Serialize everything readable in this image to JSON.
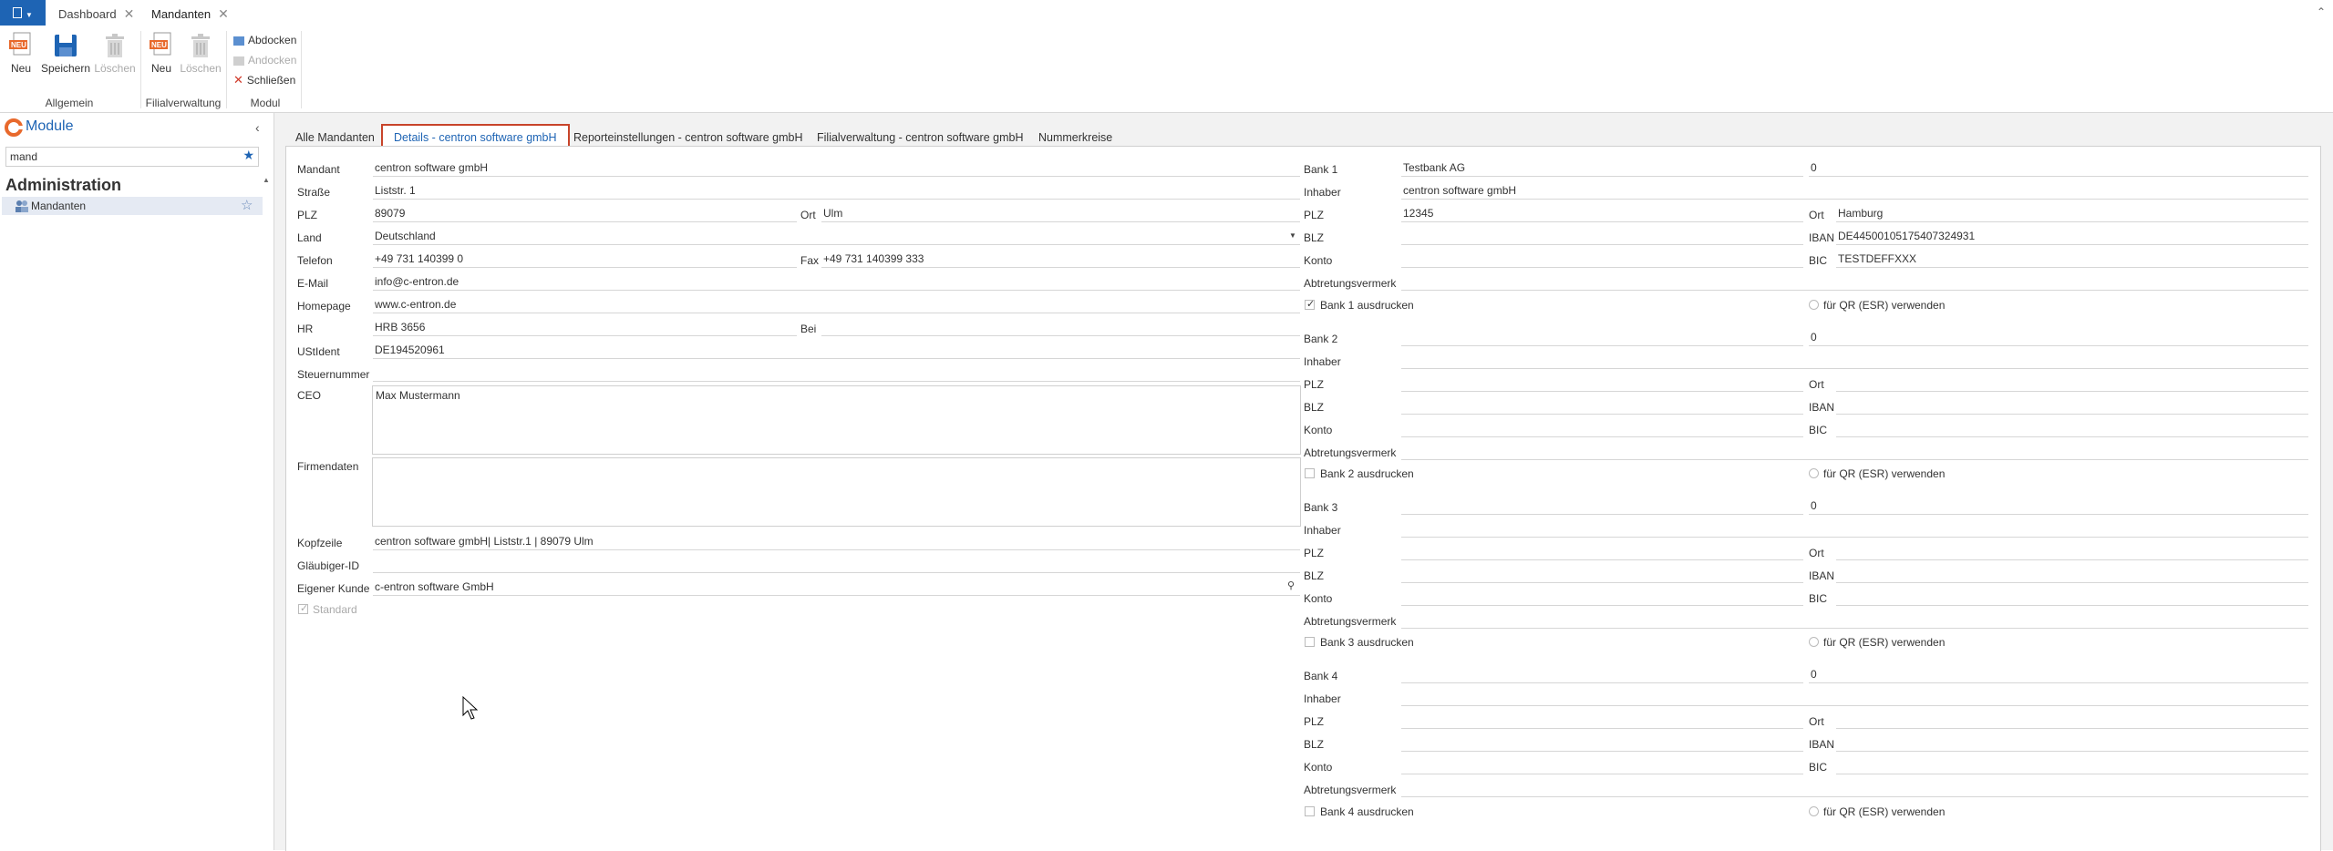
{
  "tabs": {
    "dashboard": "Dashboard",
    "mandanten": "Mandanten"
  },
  "ribbon": {
    "allgemein": {
      "neu": "Neu",
      "speichern": "Speichern",
      "loeschen": "Löschen",
      "label": "Allgemein"
    },
    "filialverwaltung": {
      "neu": "Neu",
      "loeschen": "Löschen",
      "label": "Filialverwaltung"
    },
    "modul": {
      "abdocken": "Abdocken",
      "andocken": "Andocken",
      "schliessen": "Schließen",
      "label": "Modul"
    }
  },
  "sidebar": {
    "title": "Module",
    "search_value": "mand",
    "section": "Administration",
    "item": "Mandanten"
  },
  "subtabs": [
    "Alle Mandanten",
    "Details - centron software gmbH",
    "Reporteinstellungen - centron software gmbH",
    "Filialverwaltung - centron software gmbH",
    "Nummerkreise"
  ],
  "form": {
    "mandant_label": "Mandant",
    "mandant": "centron software gmbH",
    "strasse_label": "Straße",
    "strasse": "Liststr. 1",
    "plz_label": "PLZ",
    "plz": "89079",
    "ort_label": "Ort",
    "ort": "Ulm",
    "land_label": "Land",
    "land": "Deutschland",
    "telefon_label": "Telefon",
    "telefon": "+49 731 140399 0",
    "fax_label": "Fax",
    "fax": "+49 731 140399 333",
    "email_label": "E-Mail",
    "email": "info@c-entron.de",
    "homepage_label": "Homepage",
    "homepage": "www.c-entron.de",
    "hr_label": "HR",
    "hr": "HRB 3656",
    "bei_label": "Bei",
    "bei": "",
    "ustident_label": "UStIdent",
    "ustident": "DE194520961",
    "steuernummer_label": "Steuernummer",
    "steuernummer": "",
    "ceo_label": "CEO",
    "ceo": "Max Mustermann",
    "firmendaten_label": "Firmendaten",
    "firmendaten": "",
    "kopfzeile_label": "Kopfzeile",
    "kopfzeile": "centron software gmbH| Liststr.1 | 89079  Ulm",
    "glaeubiger_label": "Gläubiger-ID",
    "glaeubiger": "",
    "eigener_kunde_label": "Eigener Kunde",
    "eigener_kunde": "c-entron software GmbH",
    "standard_label": "Standard"
  },
  "banks": [
    {
      "label": "Bank 1",
      "name": "Testbank AG",
      "number": "0",
      "inhaber_label": "Inhaber",
      "inhaber": "centron software gmbH",
      "plz_label": "PLZ",
      "plz": "12345",
      "ort_label": "Ort",
      "ort": "Hamburg",
      "blz_label": "BLZ",
      "blz": "",
      "iban_label": "IBAN",
      "iban": "DE44500105175407324931",
      "konto_label": "Konto",
      "konto": "",
      "bic_label": "BIC",
      "bic": "TESTDEFFXXX",
      "abtretung_label": "Abtretungsvermerk",
      "print_label": "Bank 1 ausdrucken",
      "qr_label": "für QR (ESR) verwenden"
    },
    {
      "label": "Bank 2",
      "name": "",
      "number": "0",
      "inhaber_label": "Inhaber",
      "inhaber": "",
      "plz_label": "PLZ",
      "plz": "",
      "ort_label": "Ort",
      "ort": "",
      "blz_label": "BLZ",
      "blz": "",
      "iban_label": "IBAN",
      "iban": "",
      "konto_label": "Konto",
      "konto": "",
      "bic_label": "BIC",
      "bic": "",
      "abtretung_label": "Abtretungsvermerk",
      "print_label": "Bank 2 ausdrucken",
      "qr_label": "für QR (ESR) verwenden"
    },
    {
      "label": "Bank 3",
      "name": "",
      "number": "0",
      "inhaber_label": "Inhaber",
      "inhaber": "",
      "plz_label": "PLZ",
      "plz": "",
      "ort_label": "Ort",
      "ort": "",
      "blz_label": "BLZ",
      "blz": "",
      "iban_label": "IBAN",
      "iban": "",
      "konto_label": "Konto",
      "konto": "",
      "bic_label": "BIC",
      "bic": "",
      "abtretung_label": "Abtretungsvermerk",
      "print_label": "Bank 3 ausdrucken",
      "qr_label": "für QR (ESR) verwenden"
    },
    {
      "label": "Bank 4",
      "name": "",
      "number": "0",
      "inhaber_label": "Inhaber",
      "inhaber": "",
      "plz_label": "PLZ",
      "plz": "",
      "ort_label": "Ort",
      "ort": "",
      "blz_label": "BLZ",
      "blz": "",
      "iban_label": "IBAN",
      "iban": "",
      "konto_label": "Konto",
      "konto": "",
      "bic_label": "BIC",
      "bic": "",
      "abtretung_label": "Abtretungsvermerk",
      "print_label": "Bank 4 ausdrucken",
      "qr_label": "für QR (ESR) verwenden"
    }
  ],
  "colors": {
    "accent": "#1e64b4",
    "highlight_border": "#c8442a",
    "brand_orange": "#e8692c"
  }
}
